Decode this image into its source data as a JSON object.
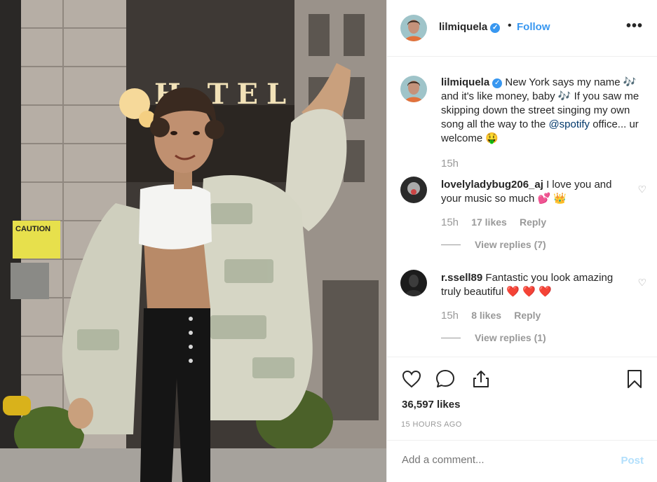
{
  "post": {
    "photo_alt": "",
    "author": {
      "username": "lilmiquela",
      "verified": true
    },
    "follow_label": "Follow",
    "dot": "•",
    "more_label": "•••"
  },
  "caption": {
    "username": "lilmiquela",
    "text_before_mention": " New York says my name 🎶 and it's like money, baby 🎶 If you saw me skipping down the street singing my own song all the way to the ",
    "mention": "@spotify",
    "text_after_mention": " office... ur welcome 🤑",
    "time": "15h"
  },
  "comments": [
    {
      "username": "lovelyladybug206_aj",
      "text": " I love you and your music so much 💕 👑",
      "time": "15h",
      "likes": "17 likes",
      "reply_label": "Reply",
      "view_replies": "View replies (7)"
    },
    {
      "username": "r.ssell89",
      "text": " Fantastic you look amazing truly beautiful ❤️ ❤️ ❤️",
      "time": "15h",
      "likes": "8 likes",
      "reply_label": "Reply",
      "view_replies": "View replies (1)"
    }
  ],
  "actions": {
    "icons": [
      "heart-icon",
      "comment-icon",
      "share-icon",
      "bookmark-icon"
    ],
    "likes_count": "36,597 likes",
    "time_ago": "15 HOURS AGO"
  },
  "add_comment": {
    "placeholder": "Add a comment...",
    "post_label": "Post"
  },
  "photo_sign": {
    "hotel_letters": "H TEL",
    "caution": "CAUTION"
  },
  "colors": {
    "accent": "#3897f0",
    "muted": "#999999",
    "post_disabled": "#b2dffc",
    "mention": "#00376b"
  }
}
